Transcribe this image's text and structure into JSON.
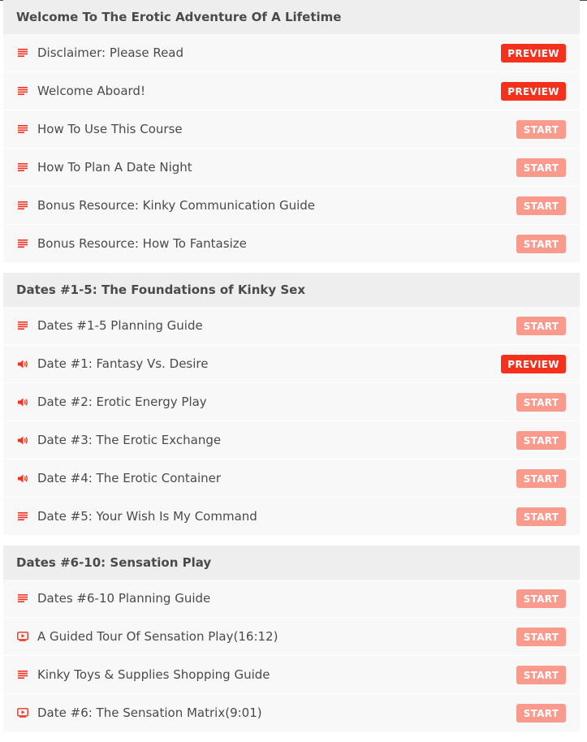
{
  "colors": {
    "accent": "#f4311d",
    "start_button": "#f99a8d",
    "row_bg": "#f8f8f8",
    "header_bg": "#eeeeee"
  },
  "sections": [
    {
      "title": "Welcome To The Erotic Adventure Of A Lifetime",
      "lectures": [
        {
          "title": "Disclaimer: Please Read",
          "icon": "text-lines-icon",
          "button": "PREVIEW"
        },
        {
          "title": "Welcome Aboard!",
          "icon": "text-lines-icon",
          "button": "PREVIEW"
        },
        {
          "title": "How To Use This Course",
          "icon": "text-lines-icon",
          "button": "START"
        },
        {
          "title": "How To Plan A Date Night",
          "icon": "text-lines-icon",
          "button": "START"
        },
        {
          "title": "Bonus Resource: Kinky Communication Guide",
          "icon": "text-lines-icon",
          "button": "START"
        },
        {
          "title": "Bonus Resource: How To Fantasize",
          "icon": "text-lines-icon",
          "button": "START"
        }
      ]
    },
    {
      "title": "Dates #1-5: The Foundations of Kinky Sex",
      "lectures": [
        {
          "title": "Dates #1-5 Planning Guide",
          "icon": "text-lines-icon",
          "button": "START"
        },
        {
          "title": "Date #1: Fantasy Vs. Desire",
          "icon": "speaker-icon",
          "button": "PREVIEW"
        },
        {
          "title": "Date #2: Erotic Energy Play",
          "icon": "speaker-icon",
          "button": "START"
        },
        {
          "title": "Date #3: The Erotic Exchange",
          "icon": "speaker-icon",
          "button": "START"
        },
        {
          "title": "Date #4: The Erotic Container",
          "icon": "speaker-icon",
          "button": "START"
        },
        {
          "title": "Date #5: Your Wish Is My Command",
          "icon": "text-lines-icon",
          "button": "START"
        }
      ]
    },
    {
      "title": "Dates #6-10: Sensation Play",
      "lectures": [
        {
          "title": "Dates #6-10 Planning Guide",
          "icon": "text-lines-icon",
          "button": "START"
        },
        {
          "title": "A Guided Tour Of Sensation Play(16:12)",
          "icon": "video-play-icon",
          "button": "START"
        },
        {
          "title": "Kinky Toys & Supplies Shopping Guide",
          "icon": "text-lines-icon",
          "button": "START"
        },
        {
          "title": "Date #6: The Sensation Matrix(9:01)",
          "icon": "video-play-icon",
          "button": "START"
        }
      ]
    }
  ]
}
